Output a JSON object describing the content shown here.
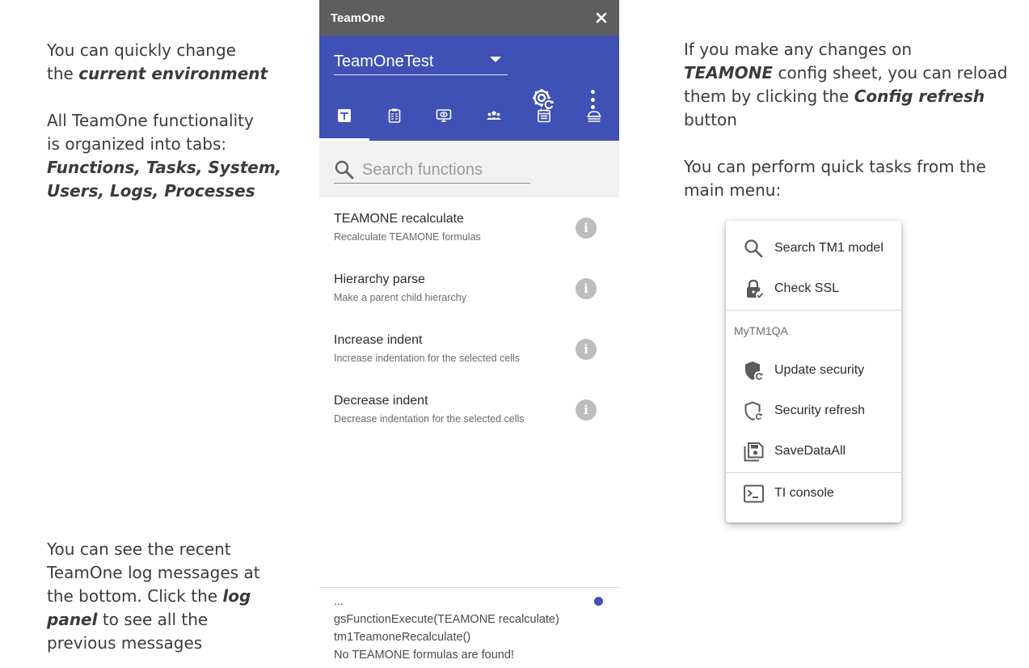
{
  "notes": {
    "env": {
      "line1": "You can quickly change",
      "line2_prefix": "the ",
      "line2_em": "current environment"
    },
    "tabs": {
      "line1": "All TeamOne functionality",
      "line2": "is organized into tabs:",
      "line3": "Functions, Tasks, System,",
      "line4": "Users, Logs, Processes"
    },
    "log": {
      "line1": "You can see the recent",
      "line2": "TeamOne log messages at",
      "line3_prefix": "the bottom. Click the ",
      "line3_em": "log",
      "line4_em": "panel",
      "line4_suffix": " to see all the",
      "line5": "previous messages"
    },
    "config": {
      "line1": "If you make any changes on",
      "line2_em": "TEAMONE",
      "line2_suffix": " config sheet, you can reload",
      "line3_prefix": "them by clicking the ",
      "line3_em": "Config refresh",
      "line4": "button"
    },
    "menu": {
      "line1": "You can perform quick tasks from the",
      "line2": "main menu:"
    }
  },
  "panel": {
    "title": "TeamOne",
    "environment": "TeamOneTest",
    "tabs": [
      {
        "name": "functions",
        "icon": "functions-tab-icon"
      },
      {
        "name": "tasks",
        "icon": "tasks-tab-icon"
      },
      {
        "name": "system",
        "icon": "system-tab-icon"
      },
      {
        "name": "users",
        "icon": "users-tab-icon"
      },
      {
        "name": "logs",
        "icon": "logs-tab-icon"
      },
      {
        "name": "processes",
        "icon": "processes-tab-icon"
      }
    ],
    "active_tab": "functions",
    "search": {
      "placeholder": "Search functions",
      "value": ""
    },
    "functions": [
      {
        "title": "TEAMONE recalculate",
        "description": "Recalculate TEAMONE formulas"
      },
      {
        "title": "Hierarchy parse",
        "description": "Make a parent child hierarchy"
      },
      {
        "title": "Increase indent",
        "description": "Increase indentation for the selected cells"
      },
      {
        "title": "Decrease indent",
        "description": "Decrease indentation for the selected cells"
      }
    ],
    "info_glyph": "i",
    "log": [
      "...",
      "gsFunctionExecute(TEAMONE recalculate)",
      "tm1TeamoneRecalculate()",
      "No TEAMONE formulas are found!"
    ],
    "colors": {
      "header": "#3f51b5",
      "titlebar": "#5e5e5e",
      "search_bg": "#f1f1f1",
      "info": "#bdbdbd"
    }
  },
  "menu": {
    "items_top": [
      {
        "label": "Search TM1 model",
        "icon": "search-icon"
      },
      {
        "label": "Check SSL",
        "icon": "lock-check-icon"
      }
    ],
    "section_label": "MyTM1QA",
    "items_section": [
      {
        "label": "Update security",
        "icon": "shield-update-icon"
      },
      {
        "label": "Security refresh",
        "icon": "shield-refresh-icon"
      },
      {
        "label": "SaveDataAll",
        "icon": "save-data-icon"
      }
    ],
    "items_bottom": [
      {
        "label": "TI console",
        "icon": "console-icon"
      }
    ]
  }
}
